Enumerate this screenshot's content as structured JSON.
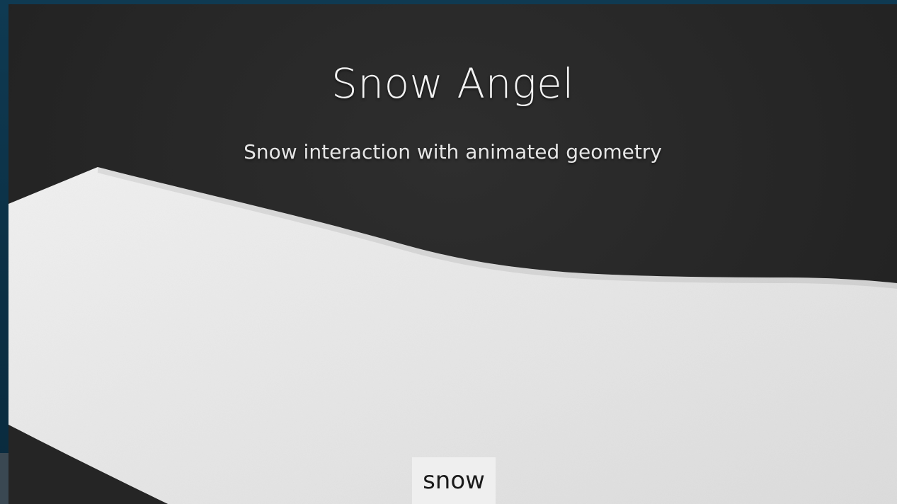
{
  "header": {
    "title": "Snow Angel",
    "subtitle": "Snow interaction with animated geometry"
  },
  "controls": {
    "mode_label": "snow"
  },
  "colors": {
    "frame": "#0f3a52",
    "background": "#262626",
    "snow": "#e8e8e8",
    "text": "#f2f2f2",
    "button": "#efefef"
  }
}
